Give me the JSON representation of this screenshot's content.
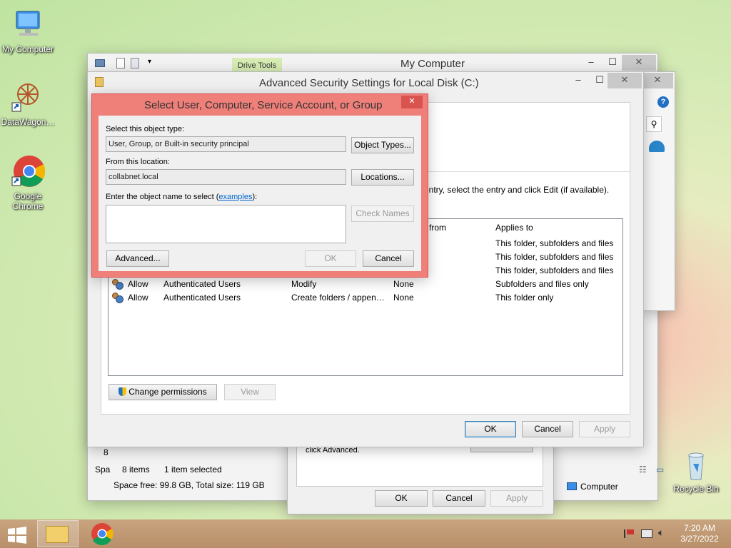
{
  "desktop": {
    "icons": [
      {
        "label": "My Computer"
      },
      {
        "label": "DataWagon…"
      },
      {
        "label": "Google Chrome"
      },
      {
        "label": "Recycle Bin"
      }
    ]
  },
  "explorer": {
    "title": "My Computer",
    "ribbon_tab": "Drive Tools",
    "status_items": "8 items",
    "status_selected": "1 item selected",
    "space_line": "Space free: 99.8 GB, Total size: 119 GB",
    "computer_label": "Computer",
    "left_fragment_a": "8",
    "left_fragment_b": "Spa"
  },
  "properties": {
    "text": "click Advanced.",
    "ok": "OK",
    "cancel": "Cancel",
    "apply": "Apply"
  },
  "adv": {
    "title": "Advanced Security Settings for Local Disk (C:)",
    "instruction": "entry, select the entry and click Edit (if available).",
    "columns": {
      "from": "from",
      "applies": "Applies to"
    },
    "rows_upper": [
      {
        "applies": "This folder, subfolders and files"
      },
      {
        "applies": "This folder, subfolders and files"
      },
      {
        "applies": "This folder, subfolders and files"
      }
    ],
    "rows": [
      {
        "type": "Allow",
        "principal": "Authenticated Users",
        "access": "Modify",
        "inherited": "None",
        "applies": "Subfolders and files only"
      },
      {
        "type": "Allow",
        "principal": "Authenticated Users",
        "access": "Create folders / appen…",
        "inherited": "None",
        "applies": "This folder only"
      }
    ],
    "change_permissions": "Change permissions",
    "view": "View",
    "ok": "OK",
    "cancel": "Cancel",
    "apply": "Apply"
  },
  "select": {
    "title": "Select User, Computer, Service Account, or Group",
    "object_type_label": "Select this object type:",
    "object_type_value": "User, Group, or Built-in security principal",
    "object_types_btn": "Object Types...",
    "location_label": "From this location:",
    "location_value": "collabnet.local",
    "locations_btn": "Locations...",
    "name_label": "Enter the object name to select (",
    "examples_link": "examples",
    "name_label_end": "):",
    "name_value": "",
    "check_names": "Check Names",
    "advanced": "Advanced...",
    "ok": "OK",
    "cancel": "Cancel"
  },
  "taskbar": {
    "time": "7:20 AM",
    "date": "3/27/2022"
  }
}
